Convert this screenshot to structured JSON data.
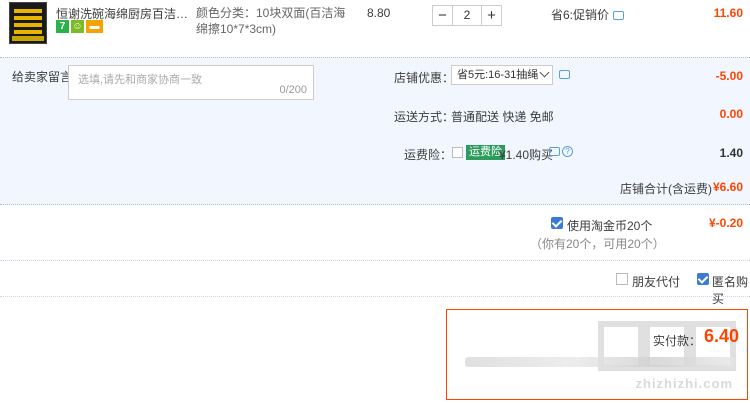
{
  "product": {
    "title": "恒谢洗碗海绵厨房百洁布双面刷...",
    "badges": [
      "7",
      "",
      ""
    ],
    "sku": "颜色分类：10块双面(百洁海绵擦10*7*3cm)",
    "unit_price": "8.80",
    "qty": "2",
    "qty_minus": "−",
    "qty_plus": "+",
    "promo": "省6:促销价",
    "subtotal": "11.60"
  },
  "panel": {
    "message_label": "给卖家留言：",
    "message_placeholder": "选填,请先和商家协商一致",
    "message_count": "0/200",
    "shop_discount_label": "店铺优惠：",
    "shop_discount_select": "省5元:16-31抽绳",
    "shop_discount_amount": "-5.00",
    "shipping_label": "运送方式：",
    "shipping_method": "普通配送 快递 免邮",
    "shipping_amount": "0.00",
    "insurance_label": "运费险：",
    "insurance_tag": "运费险",
    "insurance_price": "¥1.40购买",
    "insurance_help": "?",
    "insurance_amount": "1.40",
    "shop_total_label": "店铺合计(含运费)",
    "shop_total_amount": "¥6.60"
  },
  "coins": {
    "label": "使用淘金币20个",
    "sub": "（你有20个，可用20个）",
    "amount": "¥-0.20"
  },
  "options": {
    "friend_pay": "朋友代付",
    "anonymous": "匿名购买"
  },
  "total": {
    "label": "实付款：",
    "amount": "6.40",
    "watermark": "zhizhizhi.com"
  }
}
